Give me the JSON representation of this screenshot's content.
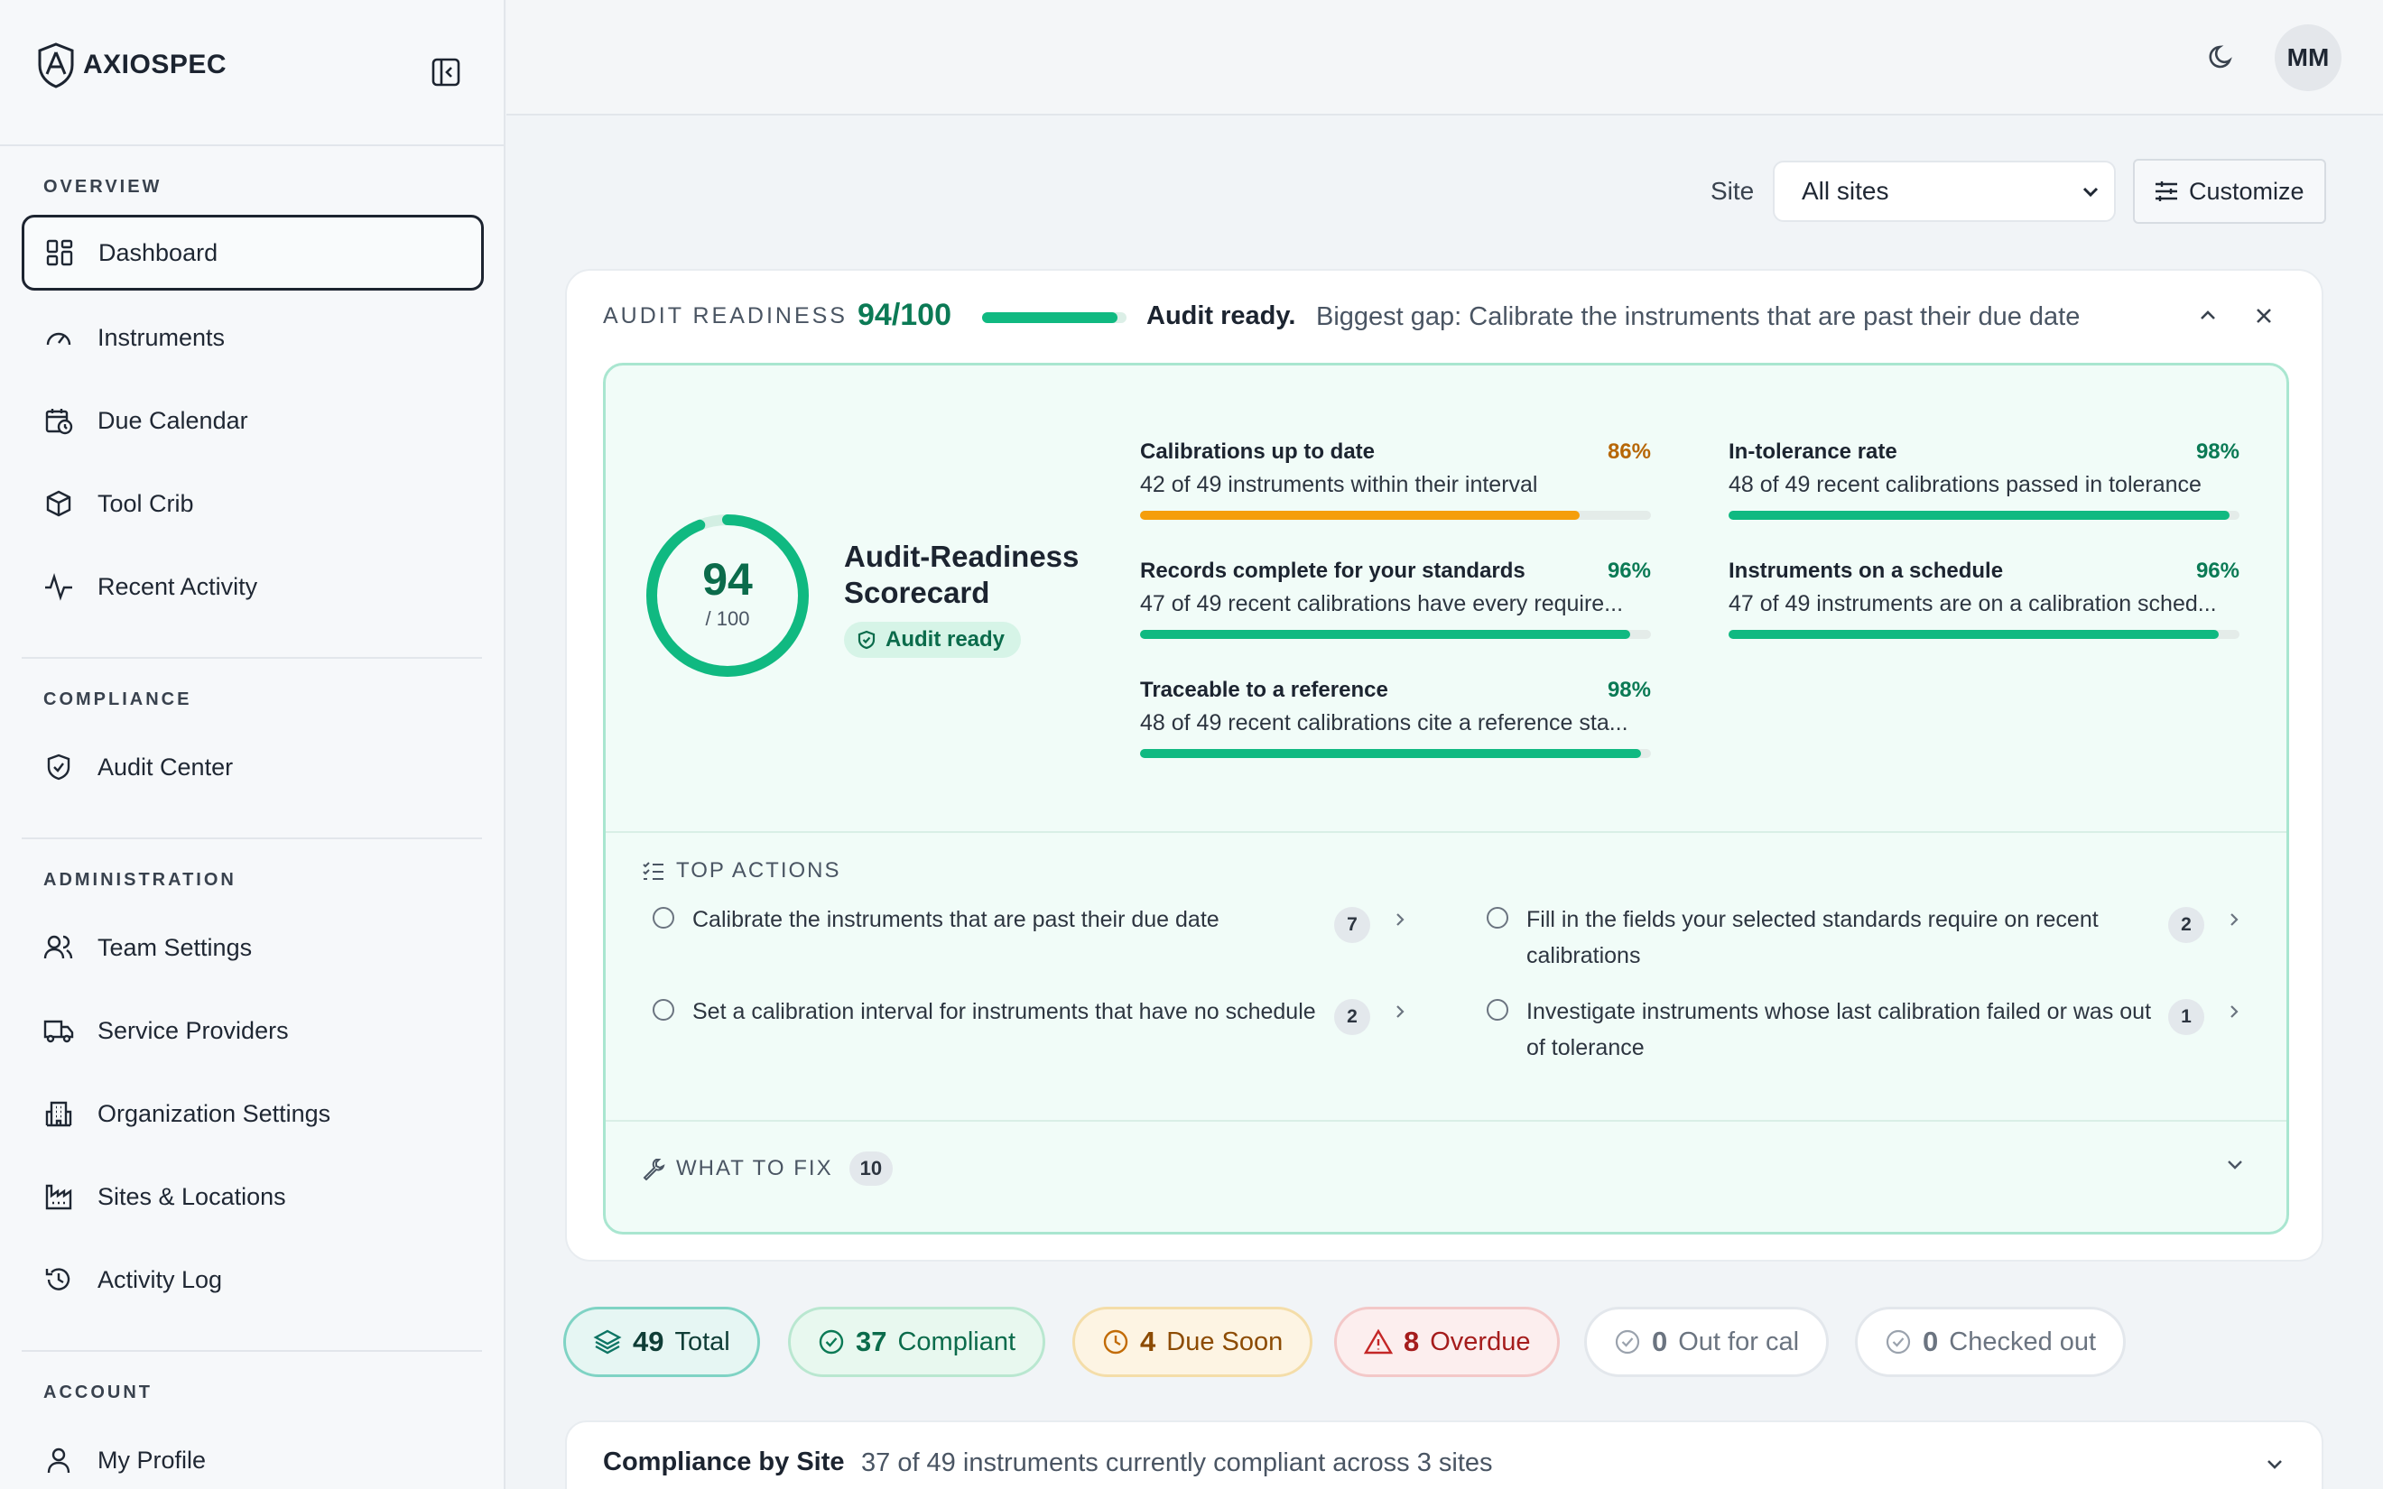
{
  "brand": {
    "name": "AXIOSPEC"
  },
  "sidebar": {
    "sections": [
      {
        "label": "OVERVIEW"
      },
      {
        "label": "COMPLIANCE"
      },
      {
        "label": "ADMINISTRATION"
      },
      {
        "label": "ACCOUNT"
      }
    ],
    "items": [
      {
        "label": "Dashboard",
        "icon": "dashboard-icon",
        "active": true
      },
      {
        "label": "Instruments",
        "icon": "gauge-icon"
      },
      {
        "label": "Due Calendar",
        "icon": "calendar-clock-icon"
      },
      {
        "label": "Tool Crib",
        "icon": "box-icon"
      },
      {
        "label": "Recent Activity",
        "icon": "activity-icon"
      },
      {
        "label": "Audit Center",
        "icon": "shield-check-icon"
      },
      {
        "label": "Team Settings",
        "icon": "users-icon"
      },
      {
        "label": "Service Providers",
        "icon": "truck-icon"
      },
      {
        "label": "Organization Settings",
        "icon": "building-icon"
      },
      {
        "label": "Sites & Locations",
        "icon": "factory-icon"
      },
      {
        "label": "Activity Log",
        "icon": "history-icon"
      },
      {
        "label": "My Profile",
        "icon": "user-icon"
      }
    ]
  },
  "topbar": {
    "avatar_initials": "MM"
  },
  "filters": {
    "site_label": "Site",
    "site_value": "All sites",
    "customize_label": "Customize"
  },
  "audit": {
    "label": "AUDIT READINESS",
    "score": "94/100",
    "score_value": 94,
    "status": "Audit ready.",
    "gap": "Biggest gap: Calibrate the instruments that are past their due date",
    "ring_number": "94",
    "ring_denominator": "/ 100",
    "scorecard_title": "Audit-Readiness Scorecard",
    "badge": "Audit ready",
    "metrics": [
      {
        "title": "Calibrations up to date",
        "pct": "86%",
        "value": 86,
        "sub": "42 of 49 instruments within their interval",
        "color": "orange"
      },
      {
        "title": "In-tolerance rate",
        "pct": "98%",
        "value": 98,
        "sub": "48 of 49 recent calibrations passed in tolerance",
        "color": "green"
      },
      {
        "title": "Records complete for your standards",
        "pct": "96%",
        "value": 96,
        "sub": "47 of 49 recent calibrations have every require...",
        "color": "green"
      },
      {
        "title": "Instruments on a schedule",
        "pct": "96%",
        "value": 96,
        "sub": "47 of 49 instruments are on a calibration sched...",
        "color": "green"
      },
      {
        "title": "Traceable to a reference",
        "pct": "98%",
        "value": 98,
        "sub": "48 of 49 recent calibrations cite a reference sta...",
        "color": "green"
      }
    ],
    "top_actions_label": "TOP ACTIONS",
    "actions": [
      {
        "text": "Calibrate the instruments that are past their due date",
        "count": "7"
      },
      {
        "text": "Fill in the fields your selected standards require on recent calibrations",
        "count": "2"
      },
      {
        "text": "Set a calibration interval for instruments that have no schedule",
        "count": "2"
      },
      {
        "text": "Investigate instruments whose last calibration failed or was out of tolerance",
        "count": "1"
      }
    ],
    "what_to_fix_label": "WHAT TO FIX",
    "what_to_fix_count": "10"
  },
  "stats": [
    {
      "num": "49",
      "label": "Total"
    },
    {
      "num": "37",
      "label": "Compliant"
    },
    {
      "num": "4",
      "label": "Due Soon"
    },
    {
      "num": "8",
      "label": "Overdue"
    },
    {
      "num": "0",
      "label": "Out for cal"
    },
    {
      "num": "0",
      "label": "Checked out"
    }
  ],
  "compliance_by_site": {
    "title": "Compliance by Site",
    "subtitle": "37 of 49 instruments currently compliant across 3 sites"
  },
  "colors": {
    "accent": "#10b981",
    "warning": "#f59e0b",
    "danger": "#dc2626",
    "brand_dark": "#1c2430"
  }
}
